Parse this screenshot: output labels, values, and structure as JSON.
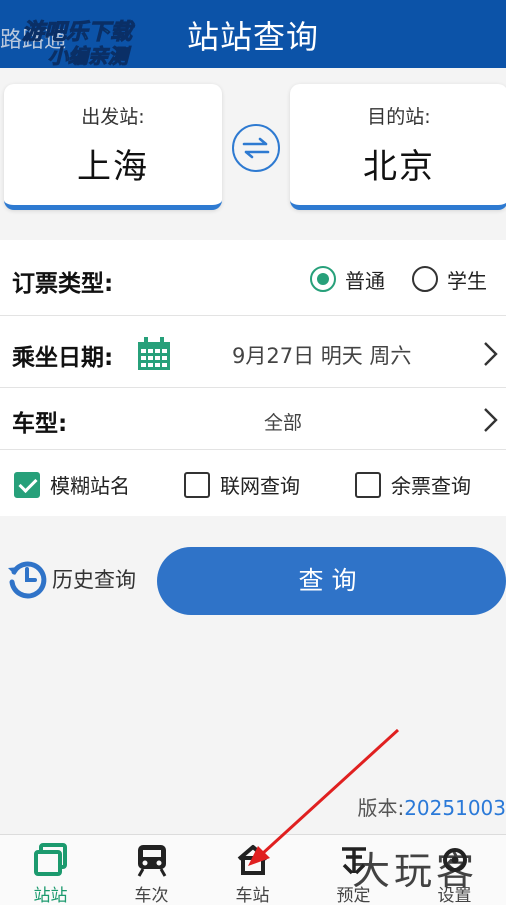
{
  "header": {
    "title": "站站查询",
    "watermark_ghost": "路路通",
    "watermark_line1": "游吧乐下载",
    "watermark_line2": "小编亲测"
  },
  "stations": {
    "from_label": "出发站:",
    "from_value": "上海",
    "to_label": "目的站:",
    "to_value": "北京"
  },
  "form": {
    "ticket_type_label": "订票类型:",
    "ticket_options": [
      "普通",
      "学生"
    ],
    "ticket_selected": "普通",
    "date_label": "乘坐日期:",
    "date_value": "9月27日 明天 周六",
    "train_type_label": "车型:",
    "train_type_value": "全部",
    "checkboxes": [
      {
        "label": "模糊站名",
        "checked": true
      },
      {
        "label": "联网查询",
        "checked": false
      },
      {
        "label": "余票查询",
        "checked": false
      }
    ]
  },
  "actions": {
    "history_label": "历史查询",
    "query_label": "查询"
  },
  "version": {
    "label": "版本:",
    "number": "20251003"
  },
  "nav": {
    "tabs": [
      {
        "label": "站站",
        "icon": "station-icon",
        "active": true
      },
      {
        "label": "车次",
        "icon": "train-icon",
        "active": false
      },
      {
        "label": "车站",
        "icon": "home-icon",
        "active": false
      },
      {
        "label": "预定",
        "icon": "booking-icon",
        "active": false
      },
      {
        "label": "设置",
        "icon": "gear-icon",
        "active": false
      }
    ]
  },
  "overlay_brand": "大玩客",
  "colors": {
    "header": "#0c53a8",
    "accent_blue": "#2f73c8",
    "accent_green": "#27a07a",
    "arrow_red": "#e02020"
  }
}
